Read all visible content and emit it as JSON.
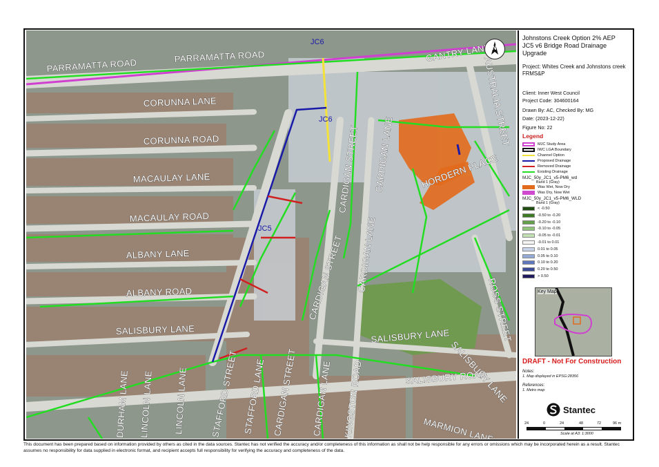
{
  "title": {
    "line1": "Johnstons Creek Option 2% AEP",
    "line2": "JC5 v6 Bridge Road Drainage",
    "line3": "Upgrade"
  },
  "project": "Project: Whites Creek and Johnstons creek FRMS&P",
  "client": "Client: Inner West Council",
  "project_code": "Project Code: 304600164",
  "drawn_by": "Drawn By: AC, Checked By: MG",
  "date": "Date: (2023-12-22)",
  "figure_no": "Figure No: 22",
  "north_label": "N",
  "legend": {
    "heading": "Legend",
    "items": [
      {
        "label": "MJC Study Area",
        "color": "#d040d0",
        "kind": "box"
      },
      {
        "label": "IWC LGA Boundary",
        "color": "#111111",
        "kind": "box"
      },
      {
        "label": "Channel Option",
        "color": "#f2e23a",
        "kind": "line"
      },
      {
        "label": "Proposed Drainage",
        "color": "#1a1aa8",
        "kind": "line"
      },
      {
        "label": "Removed Drainage",
        "color": "#d02020",
        "kind": "line"
      },
      {
        "label": "Existing Drainage",
        "color": "#22dd22",
        "kind": "line"
      }
    ],
    "wd_layer": "MJC_50y_JC1_v5-PM6_wd",
    "wd_band": "Band 1 (Gray)",
    "wd_items": [
      {
        "label": "Was Wet, Now Dry",
        "color": "#e26a1c"
      },
      {
        "label": "Was Dry, Now Wet",
        "color": "#d04ad0"
      }
    ],
    "wld_layer": "MJC_50y_JC1_v5-PM6_WLD",
    "wld_band": "Band 1 (Gray)",
    "wld_items": [
      {
        "label": "< -0.50",
        "color": "#1f4d12"
      },
      {
        "label": "-0.50 to -0.20",
        "color": "#3c7a26"
      },
      {
        "label": "-0.20 to -0.10",
        "color": "#62a04c"
      },
      {
        "label": "-0.10 to -0.05",
        "color": "#8fc27a"
      },
      {
        "label": "-0.05 to -0.01",
        "color": "#c2e2b4"
      },
      {
        "label": "-0.01 to 0.01",
        "color": "#f4f4f4"
      },
      {
        "label": "0.01 to 0.05",
        "color": "#c8d4ea"
      },
      {
        "label": "0.05 to 0.10",
        "color": "#93a9d6"
      },
      {
        "label": "0.10 to 0.20",
        "color": "#6078bd"
      },
      {
        "label": "0.20 to 0.50",
        "color": "#3b4b98"
      },
      {
        "label": "> 0.50",
        "color": "#1e1a5e"
      }
    ]
  },
  "key_map": {
    "label": "Key Map"
  },
  "draft": "DRAFT - Not For Construction",
  "notes": {
    "heading": "Notes:",
    "line1": "1. Map displayed in EPSG:28356"
  },
  "references": {
    "heading": "References:",
    "line1": "1. Metro map"
  },
  "brand": "Stantec",
  "scale_bar": {
    "ticks": [
      "24",
      "0",
      "24",
      "48",
      "72",
      "96 m"
    ],
    "scale_text": "Scale at A3: 1:3000"
  },
  "map_labels": {
    "streets": [
      {
        "name": "PARRAMATTA ROAD",
        "id": "parramatta-road-west"
      },
      {
        "name": "PARRAMATTA ROAD",
        "id": "parramatta-road-east"
      },
      {
        "name": "CORUNNA LANE",
        "id": "corunna-lane"
      },
      {
        "name": "CORUNNA ROAD",
        "id": "corunna-road"
      },
      {
        "name": "MACAULAY LANE",
        "id": "macaulay-lane"
      },
      {
        "name": "MACAULAY ROAD",
        "id": "macaulay-road"
      },
      {
        "name": "ALBANY LANE",
        "id": "albany-lane"
      },
      {
        "name": "ALBANY ROAD",
        "id": "albany-road"
      },
      {
        "name": "SALISBURY LANE",
        "id": "salisbury-lane-west"
      },
      {
        "name": "CARDIGAN STREET",
        "id": "cardigan-street-north"
      },
      {
        "name": "CARDIGAN LANE",
        "id": "cardigan-lane-north"
      },
      {
        "name": "CARDIGAN LANE",
        "id": "cardigan-lane-mid"
      },
      {
        "name": "CARDIGAN STREET",
        "id": "cardigan-street-mid"
      },
      {
        "name": "HORDERN PLACE",
        "id": "hordern-place"
      },
      {
        "name": "GANTRY LANE",
        "id": "gantry-lane"
      },
      {
        "name": "AUSTRALIA STREET",
        "id": "australia-street"
      },
      {
        "name": "ROSS STREET",
        "id": "ross-street"
      },
      {
        "name": "SALISBURY LANE",
        "id": "salisbury-lane-east"
      },
      {
        "name": "SALISBURY LANE",
        "id": "salisbury-lane-diag"
      },
      {
        "name": "SALISBURY ROAD",
        "id": "salisbury-road"
      },
      {
        "name": "MARMION LANE",
        "id": "marmion-lane"
      },
      {
        "name": "DURHAM LANE",
        "id": "durham-lane"
      },
      {
        "name": "LINCOLN LANE",
        "id": "lincoln-lane-west"
      },
      {
        "name": "LINCOLN LANE",
        "id": "lincoln-lane-east"
      },
      {
        "name": "STAFFORD STREET",
        "id": "stafford-street"
      },
      {
        "name": "STAFFORD LANE",
        "id": "stafford-lane"
      },
      {
        "name": "CARDIGAN STREET",
        "id": "cardigan-street-south"
      },
      {
        "name": "CARDIGAN LANE",
        "id": "cardigan-lane-south"
      },
      {
        "name": "KINGSTON ROAD",
        "id": "kingston-road"
      }
    ],
    "channels": [
      {
        "name": "JC6",
        "id": "jc6-top"
      },
      {
        "name": "JC6",
        "id": "jc6-mid"
      },
      {
        "name": "JC5",
        "id": "jc5"
      }
    ]
  },
  "disclaimer": "This document has been prepared based on information provided by others as cited in the data sources. Stantec has not verified the accuracy and/or completeness of this information as shall not be help responsible for any errors or omissions which may be incorporated herein as a result. Stantec assumes no responsibility for data supplied in electronic format, and recipient accepts full responsibility for verifying the accuracy and completeness of the data."
}
